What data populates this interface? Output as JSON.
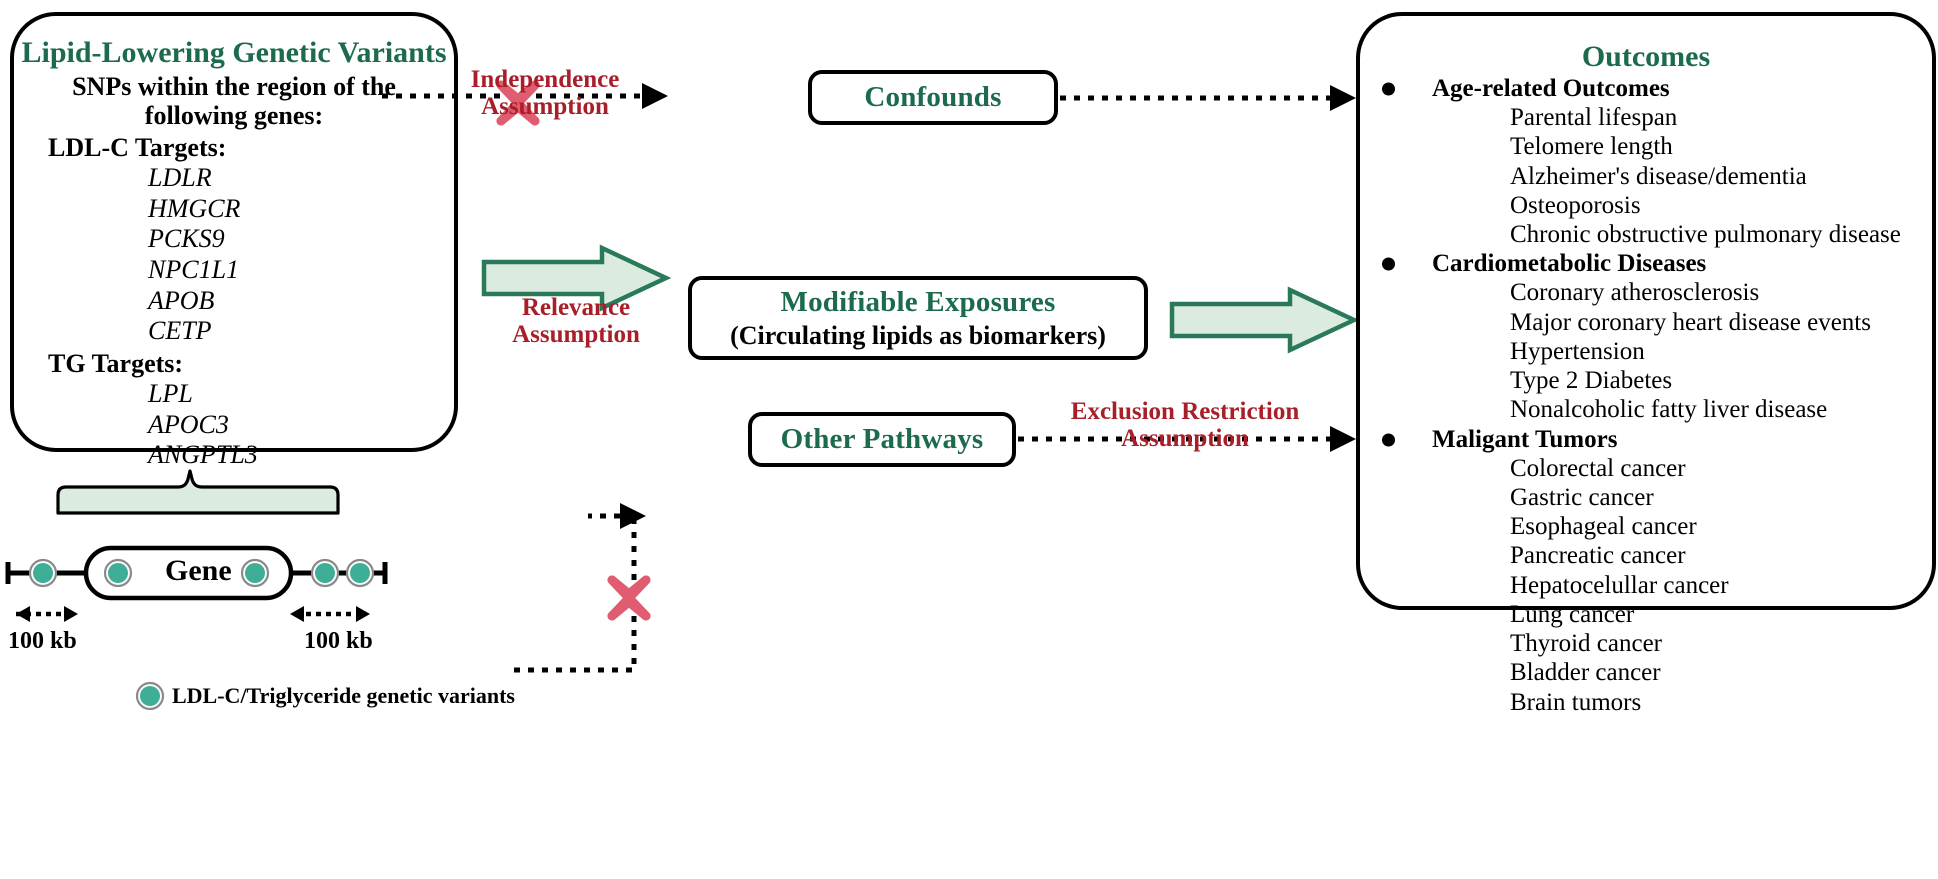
{
  "colors": {
    "green_text": "#1b6b4c",
    "dark_red": "#a81f29",
    "x_mark_pink": "#e05c70",
    "arrow_fill": "#dcebe0",
    "arrow_stroke": "#2a7a5a",
    "variant_teal": "#3fae96",
    "variant_ring": "#8a8a8a",
    "brace_fill": "#dcebe0",
    "outline_black": "#000000"
  },
  "variants_panel": {
    "title": "Lipid-Lowering Genetic Variants",
    "subtitle": "SNPs within the region of the following genes:",
    "groups": [
      {
        "label": "LDL-C Targets:",
        "genes": [
          "LDLR",
          "HMGCR",
          "PCKS9",
          "NPC1L1",
          "APOB",
          "CETP"
        ]
      },
      {
        "label": "TG Targets:",
        "genes": [
          "LPL",
          "APOC3",
          "ANGPTL3"
        ]
      }
    ]
  },
  "nodes": {
    "confounds": {
      "title": "Confounds"
    },
    "exposures": {
      "title": "Modifiable Exposures",
      "subtitle": "(Circulating lipids as biomarkers)"
    },
    "other_pathways": {
      "title": "Other Pathways"
    }
  },
  "assumptions": {
    "independence": "Independence\nAssumption",
    "independence_line1": "Independence",
    "independence_line2": "Assumption",
    "relevance_line1": "Relevance",
    "relevance_line2": "Assumption",
    "exclusion_line1": "Exclusion Restriction",
    "exclusion_line2": "Assumption"
  },
  "outcomes_panel": {
    "title": "Outcomes",
    "groups": [
      {
        "label": "Age-related Outcomes",
        "items": [
          "Parental lifespan",
          "Telomere length",
          "Alzheimer's disease/dementia",
          "Osteoporosis",
          "Chronic obstructive pulmonary disease"
        ]
      },
      {
        "label": "Cardiometabolic Diseases",
        "items": [
          "Coronary atherosclerosis",
          "Major coronary heart disease events",
          "Hypertension",
          "Type 2 Diabetes",
          "Nonalcoholic fatty liver disease"
        ]
      },
      {
        "label": "Maligant Tumors",
        "items": [
          "Colorectal cancer",
          "Gastric cancer",
          "Esophageal cancer",
          "Pancreatic cancer",
          "Hepatocelullar cancer",
          "Lung cancer",
          "Thyroid cancer",
          "Bladder cancer",
          "Brain tumors"
        ]
      }
    ]
  },
  "gene_track": {
    "gene_label": "Gene",
    "left_kb": "100 kb",
    "right_kb": "100 kb",
    "legend_text": "LDL-C/Triglyceride genetic variants",
    "variant_count": 5
  }
}
